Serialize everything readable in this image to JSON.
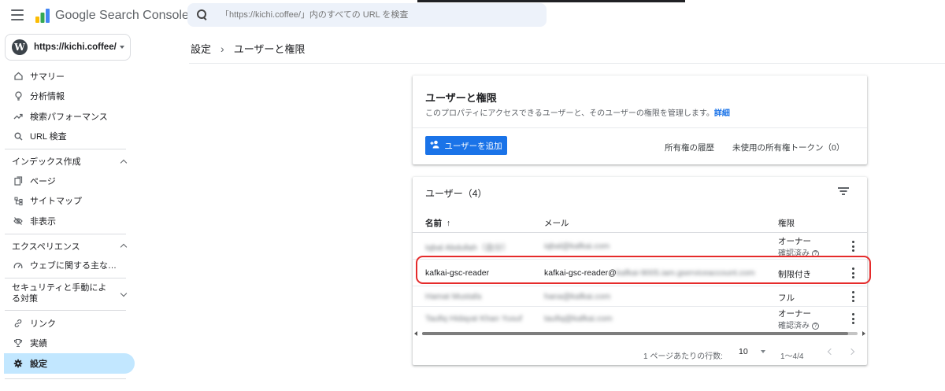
{
  "app": {
    "brand": "Google Search Console",
    "search_placeholder": "「https://kichi.coffee/」内のすべての URL を検査",
    "property": "https://kichi.coffee/"
  },
  "sidebar": {
    "items_top": [
      {
        "label": "サマリー",
        "icon": "home-icon"
      },
      {
        "label": "分析情報",
        "icon": "lightbulb-icon"
      },
      {
        "label": "検索パフォーマンス",
        "icon": "trending-icon"
      },
      {
        "label": "URL 検査",
        "icon": "search-icon"
      }
    ],
    "section_index": "インデックス作成",
    "items_index": [
      {
        "label": "ページ",
        "icon": "pages-icon"
      },
      {
        "label": "サイトマップ",
        "icon": "sitemap-icon"
      },
      {
        "label": "非表示",
        "icon": "hidden-icon"
      }
    ],
    "section_experience": "エクスペリエンス",
    "items_experience": [
      {
        "label": "ウェブに関する主な…",
        "icon": "gauge-icon"
      }
    ],
    "section_security": "セキュリティと手動による対策",
    "items_bottom": [
      {
        "label": "リンク",
        "icon": "link-icon"
      },
      {
        "label": "実績",
        "icon": "trophy-icon"
      },
      {
        "label": "設定",
        "icon": "gear-icon",
        "active": true
      }
    ]
  },
  "breadcrumb": {
    "parent": "設定",
    "current": "ユーザーと権限"
  },
  "perm_card": {
    "title": "ユーザーと権限",
    "description": "このプロパティにアクセスできるユーザーと、そのユーザーの権限を管理します。",
    "detail_link": "詳細",
    "add_user": "ユーザーを追加",
    "ownership_history": "所有権の履歴",
    "unused_tokens": "未使用の所有権トークン（0）"
  },
  "users_card": {
    "title": "ユーザー（4）",
    "columns": {
      "name": "名前",
      "email": "メール",
      "permission": "権限"
    },
    "rows": [
      {
        "name": "Iqbal Abdullah（自分）",
        "email": "iqbal@kafkai.com",
        "permission": "オーナー",
        "sub": "確認済み",
        "blurred": true
      },
      {
        "name": "kafkai-gsc-reader",
        "email_prefix": "kafkai-gsc-reader@",
        "email_rest": "kafkai-9005.iam.gserviceaccount.com",
        "permission": "制限付き",
        "highlighted": true
      },
      {
        "name": "Hamat Mustafa",
        "email": "hana@kafkai.com",
        "permission": "フル",
        "blurred": true
      },
      {
        "name": "Taufiq Hidayat Khan Yusuf",
        "email": "taufiq@kafkai.com",
        "permission": "オーナー",
        "sub": "確認済み",
        "blurred": true
      }
    ],
    "rows_per_page_label": "1 ページあたりの行数:",
    "rows_per_page": "10",
    "range": "1〜4/4"
  },
  "colors": {
    "accent": "#1a73e8",
    "active_nav": "#c2e7ff",
    "highlight_border": "#e52b2b"
  }
}
